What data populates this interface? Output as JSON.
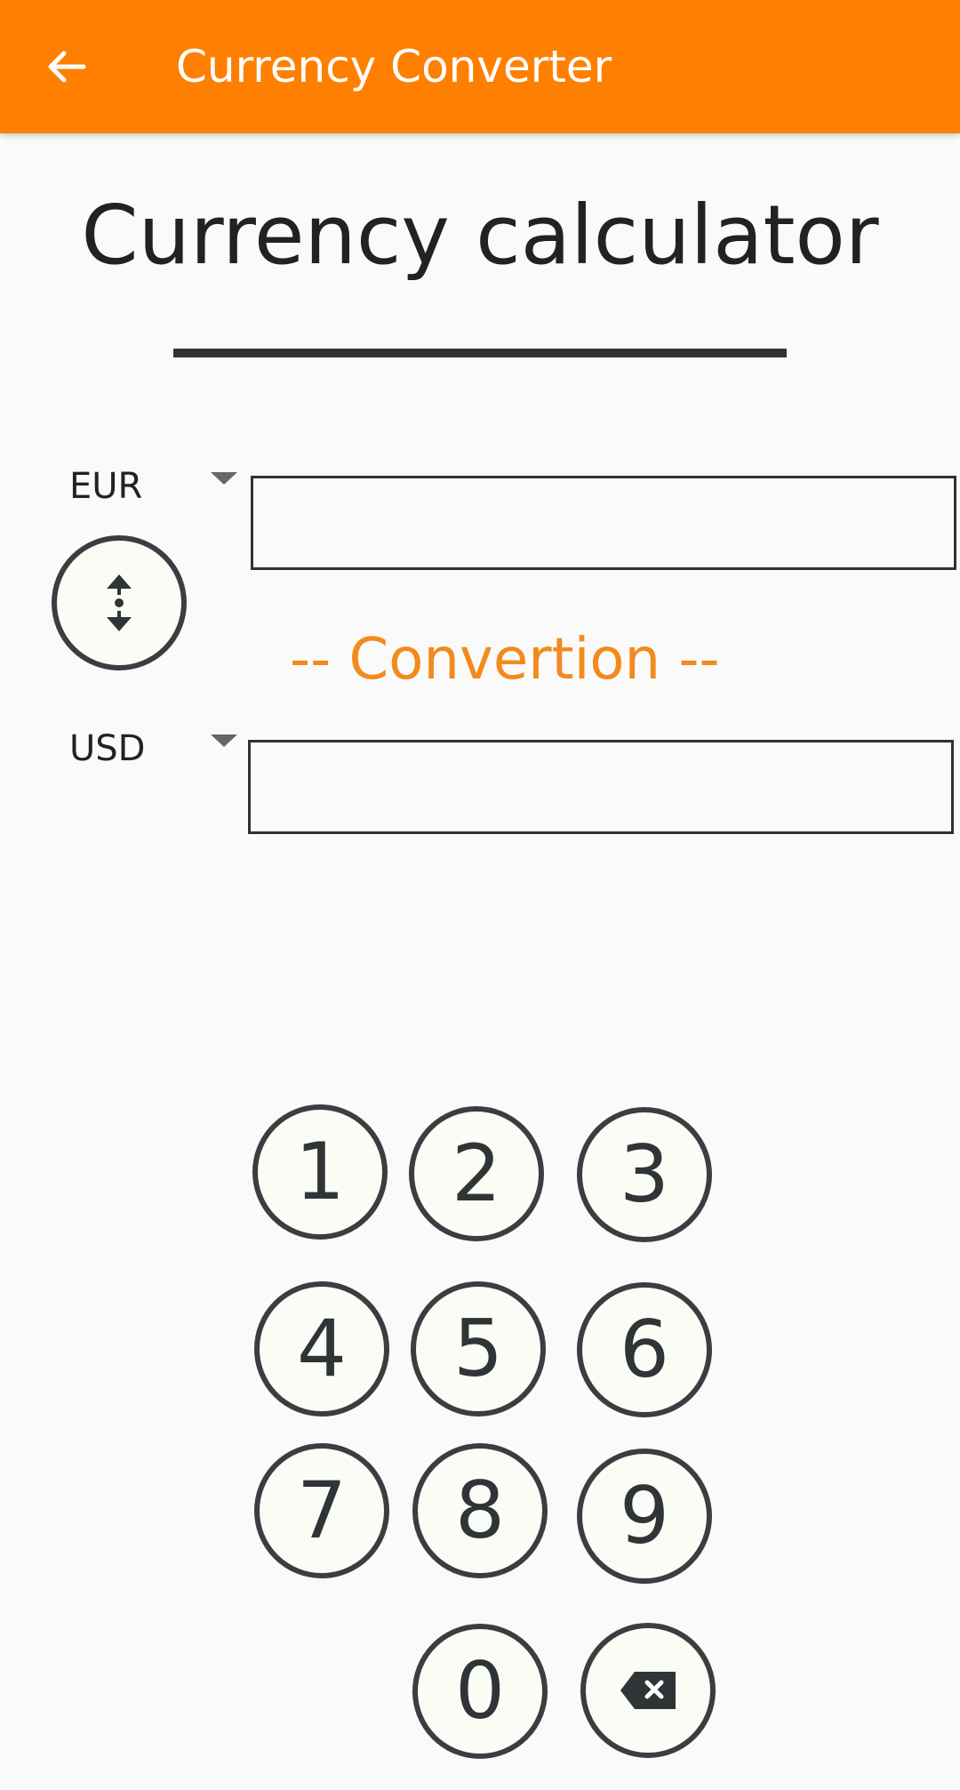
{
  "appbar": {
    "title": "Currency Converter",
    "back_icon": "arrow-left-icon",
    "background_color": "#ff7f00"
  },
  "main": {
    "heading": "Currency calculator",
    "from_currency": {
      "code": "EUR",
      "amount": ""
    },
    "to_currency": {
      "code": "USD",
      "amount": ""
    },
    "swap_icon": "swap-vertical-icon",
    "conversion_label": "-- Convertion --",
    "accent_color": "#f28a1e"
  },
  "keypad": {
    "keys": [
      "1",
      "2",
      "3",
      "4",
      "5",
      "6",
      "7",
      "8",
      "9",
      "0"
    ],
    "backspace_icon": "backspace-icon"
  }
}
